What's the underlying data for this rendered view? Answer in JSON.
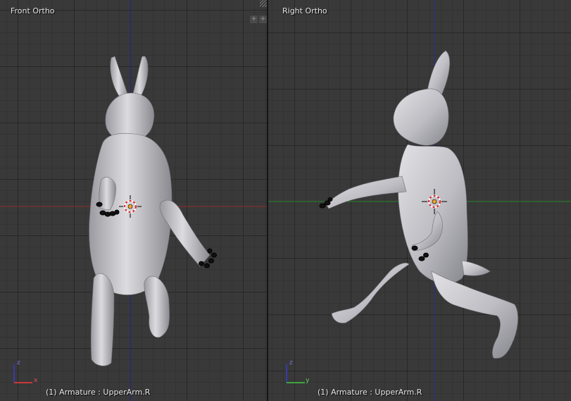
{
  "viewports": [
    {
      "id": "front",
      "title": "Front Ortho",
      "footer": "(1) Armature : UpperArm.R",
      "axes": {
        "horizontal": "x",
        "vertical": "z",
        "horizontal_color": "#c83737",
        "vertical_color": "#3a3aa8"
      }
    },
    {
      "id": "right",
      "title": "Right Ortho",
      "footer": "(1) Armature : UpperArm.R",
      "axes": {
        "horizontal": "y",
        "vertical": "z",
        "horizontal_color": "#3fa33f",
        "vertical_color": "#3a3aa8"
      }
    }
  ],
  "split_widget": {
    "left_icon": "plus-icon",
    "right_icon": "plus-icon",
    "glyph": "+"
  },
  "colors": {
    "viewport_bg": "#393939",
    "model": "#c8c8cc",
    "model_shadow": "#8c8c92",
    "bones": "#111111",
    "cursor_red": "#e02020"
  }
}
